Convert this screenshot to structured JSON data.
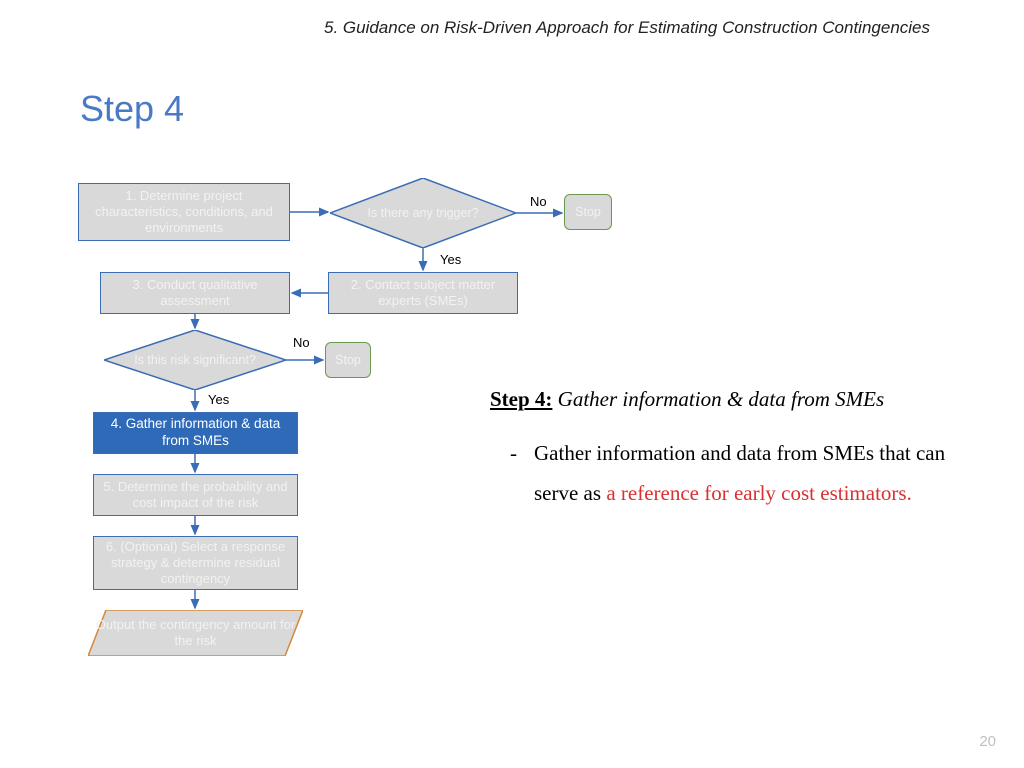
{
  "header": "5. Guidance on Risk-Driven Approach for Estimating Construction Contingencies",
  "title": "Step 4",
  "page": "20",
  "flow": {
    "b1": "1. Determine project characteristics, conditions, and environments",
    "d1": "Is there any trigger?",
    "stop1": "Stop",
    "no1": "No",
    "yes1": "Yes",
    "b2": "2. Contact subject matter experts (SMEs)",
    "b3": "3. Conduct qualitative assessment",
    "d2": "Is this risk significant?",
    "stop2": "Stop",
    "no2": "No",
    "yes2": "Yes",
    "b4": "4. Gather information & data from SMEs",
    "b5": "5. Determine the probability and cost impact of the risk",
    "b6": "6. (Optional) Select a response strategy & determine residual contingency",
    "b7": "Output the contingency amount for the risk"
  },
  "desc": {
    "lead_title": "Step 4:",
    "lead_rest": " Gather information & data from SMEs",
    "bullet_plain": "Gather information and data from SMEs that can serve as ",
    "bullet_red": "a reference for early cost estimators",
    "bullet_end": "."
  }
}
